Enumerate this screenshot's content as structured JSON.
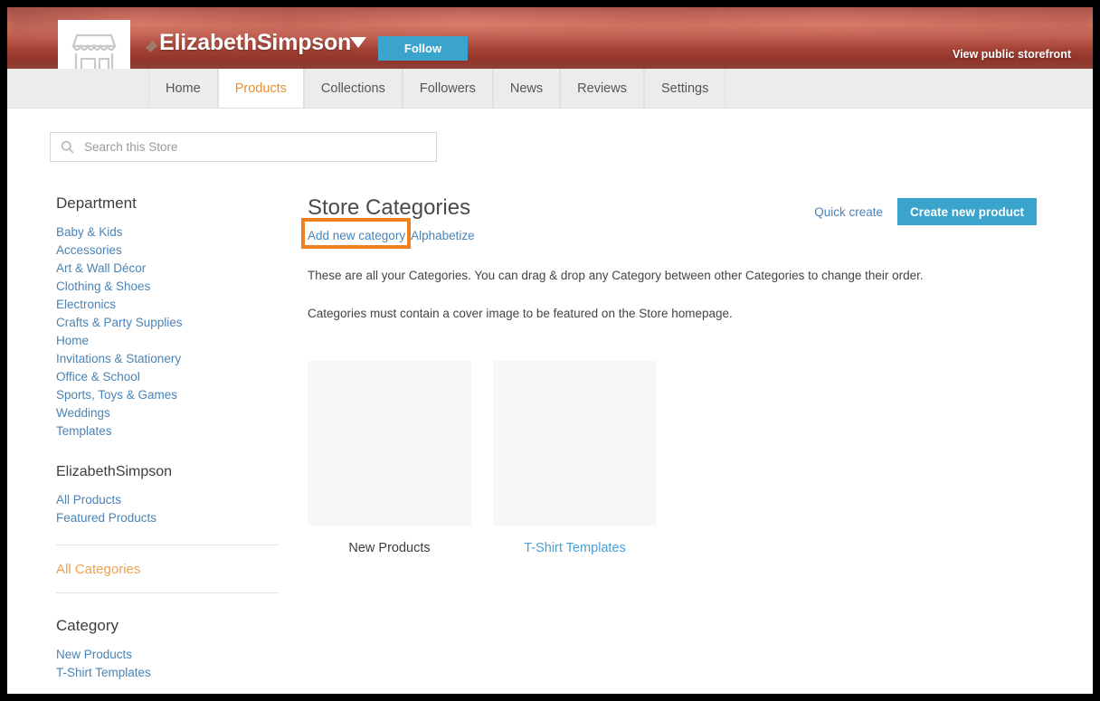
{
  "banner": {
    "store_name": "ElizabethSimpson",
    "follow_label": "Follow",
    "storefront_link": "View public storefront",
    "logo_icon": "storefront-icon",
    "pin_icon": "pin-icon",
    "caret_icon": "chevron-down-icon",
    "accent_blue": "#3ba4cd"
  },
  "nav": {
    "tabs": [
      {
        "label": "Home",
        "active": false
      },
      {
        "label": "Products",
        "active": true
      },
      {
        "label": "Collections",
        "active": false
      },
      {
        "label": "Followers",
        "active": false
      },
      {
        "label": "News",
        "active": false
      },
      {
        "label": "Reviews",
        "active": false
      },
      {
        "label": "Settings",
        "active": false
      }
    ],
    "active_color": "#e8902f"
  },
  "search": {
    "placeholder": "Search this Store",
    "value": "",
    "icon": "search-icon"
  },
  "sidebar": {
    "department_heading": "Department",
    "departments": [
      {
        "label": "Baby & Kids"
      },
      {
        "label": "Accessories"
      },
      {
        "label": "Art & Wall Décor"
      },
      {
        "label": "Clothing & Shoes"
      },
      {
        "label": "Electronics"
      },
      {
        "label": "Crafts & Party Supplies"
      },
      {
        "label": "Home"
      },
      {
        "label": "Invitations & Stationery"
      },
      {
        "label": "Office & School"
      },
      {
        "label": "Sports, Toys & Games"
      },
      {
        "label": "Weddings"
      },
      {
        "label": "Templates"
      }
    ],
    "store_heading": "ElizabethSimpson",
    "store_links": [
      {
        "label": "All Products"
      },
      {
        "label": "Featured Products"
      }
    ],
    "all_categories_label": "All Categories",
    "all_categories_color": "#efa14c",
    "category_heading": "Category",
    "categories": [
      {
        "label": "New Products"
      },
      {
        "label": "T-Shirt Templates"
      }
    ]
  },
  "content": {
    "title": "Store Categories",
    "add_new_category": "Add new category",
    "alphabetize": "Alphabetize",
    "highlight_color": "#f0801e",
    "quick_create": "Quick create",
    "create_new_product": "Create new product",
    "description_1": "These are all your Categories. You can drag & drop any Category between other Categories to change their order.",
    "description_2": "Categories must contain a cover image to be featured on the Store homepage.",
    "cards": [
      {
        "label": "New Products",
        "is_link": false
      },
      {
        "label": "T-Shirt Templates",
        "is_link": true
      }
    ]
  }
}
